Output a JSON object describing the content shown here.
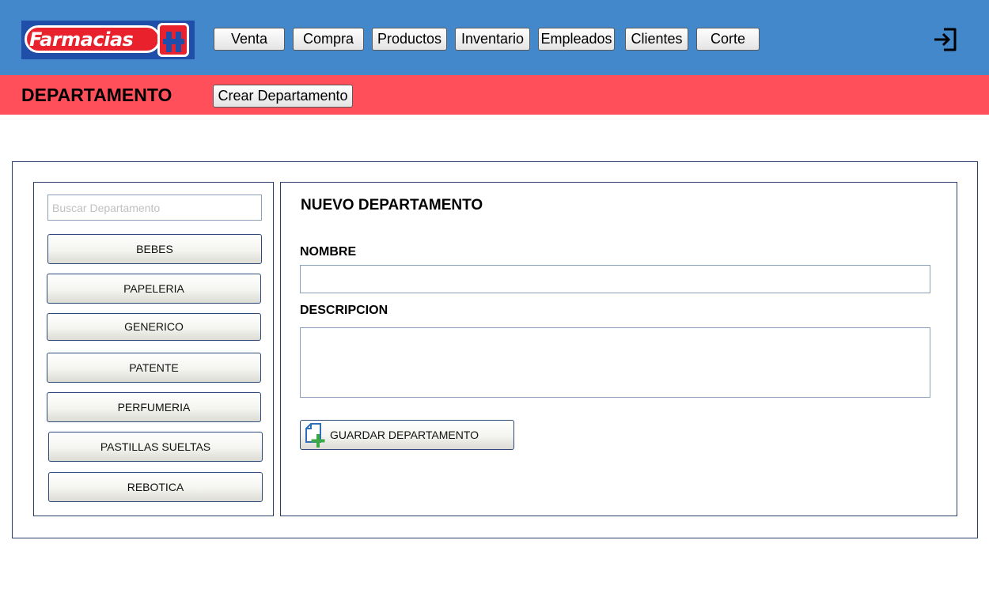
{
  "header": {
    "logo_text": "Farmacias",
    "nav": [
      {
        "label": "Venta"
      },
      {
        "label": "Compra"
      },
      {
        "label": "Productos"
      },
      {
        "label": "Inventario"
      },
      {
        "label": "Empleados"
      },
      {
        "label": "Clientes"
      },
      {
        "label": "Corte"
      }
    ],
    "exit_icon": "sign-out-icon"
  },
  "subheader": {
    "title": "DEPARTAMENTO",
    "create_label": "Crear Departamento"
  },
  "sidebar": {
    "search_placeholder": "Buscar Departamento",
    "search_value": "",
    "departments": [
      {
        "label": "BEBES"
      },
      {
        "label": "PAPELERIA"
      },
      {
        "label": "GENERICO"
      },
      {
        "label": "PATENTE"
      },
      {
        "label": "PERFUMERIA"
      },
      {
        "label": "PASTILLAS SUELTAS"
      },
      {
        "label": "REBOTICA"
      }
    ]
  },
  "form": {
    "title": "NUEVO DEPARTAMENTO",
    "name_label": "NOMBRE",
    "name_value": "",
    "description_label": "DESCRIPCION",
    "description_value": "",
    "save_label": "GUARDAR DEPARTAMENTO",
    "save_icon": "add-document-icon"
  },
  "colors": {
    "header_bg": "#4488cc",
    "subheader_bg": "#ff4f5a",
    "logo_red": "#e8212c",
    "logo_blue": "#1f4fa8",
    "panel_border": "#2a3f6b"
  }
}
